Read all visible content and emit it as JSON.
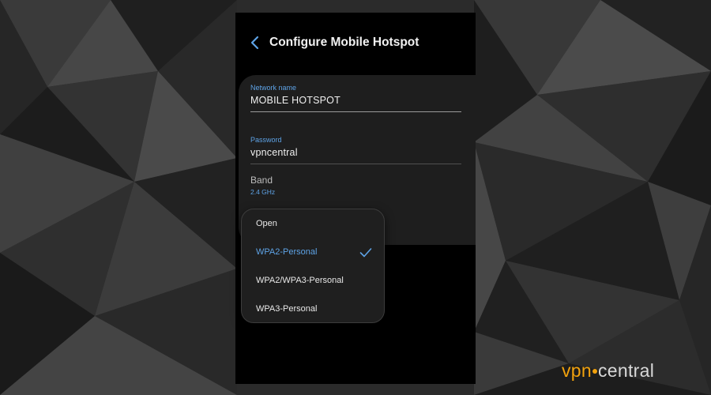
{
  "screen": {
    "title": "Configure Mobile Hotspot",
    "back_icon": "chevron-left-icon"
  },
  "form": {
    "network_name": {
      "label": "Network name",
      "value": "MOBILE HOTSPOT"
    },
    "password": {
      "label": "Password",
      "value": "vpncentral"
    },
    "band": {
      "label": "Band",
      "value": "2.4 GHz"
    }
  },
  "security_menu": {
    "items": [
      {
        "label": "Open",
        "selected": false
      },
      {
        "label": "WPA2-Personal",
        "selected": true
      },
      {
        "label": "WPA2/WPA3-Personal",
        "selected": false
      },
      {
        "label": "WPA3-Personal",
        "selected": false
      }
    ],
    "selected_icon": "checkmark-icon"
  },
  "watermark": {
    "part1": "vpn",
    "part2": "central"
  },
  "colors": {
    "accent": "#5ea3e6",
    "background": "#000000",
    "card": "#1e1e1e",
    "logo_orange": "#f2a20d"
  }
}
